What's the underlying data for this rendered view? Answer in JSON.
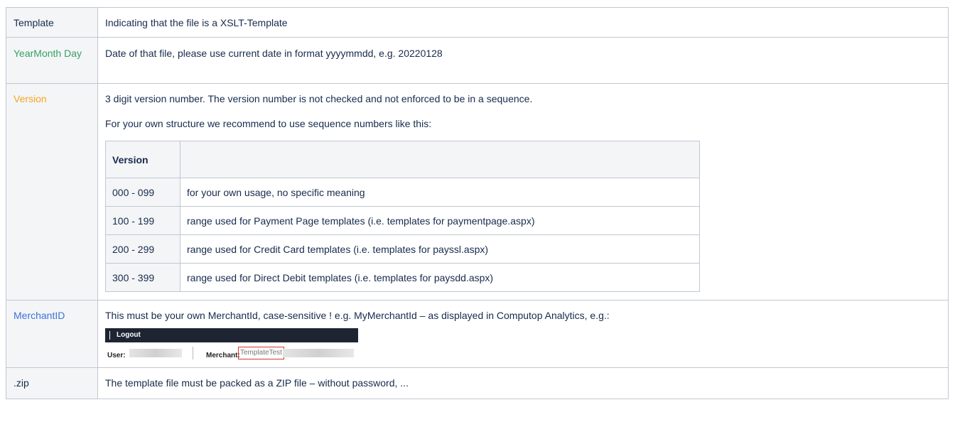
{
  "rows": {
    "template": {
      "key": "Template",
      "desc": "Indicating that the file is a XSLT-Template"
    },
    "yearmonthday": {
      "key": "YearMonth Day",
      "desc": "Date of that file, please use current date in format yyyymmdd, e.g. 20220128"
    },
    "version": {
      "key": "Version",
      "desc1": "3 digit version number. The version number is not checked and not enforced to be in a sequence.",
      "desc2": "For your own structure we recommend to use sequence numbers like this:",
      "table": {
        "header": [
          "Version",
          ""
        ],
        "rows": [
          [
            "000 - 099",
            "for your own usage, no specific meaning"
          ],
          [
            "100 - 199",
            "range used for Payment Page templates (i.e. templates for paymentpage.aspx)"
          ],
          [
            "200 - 299",
            "range used for Credit Card templates (i.e. templates for payssl.aspx)"
          ],
          [
            "300 - 399",
            "range used for Direct Debit templates (i.e. templates for paysdd.aspx)"
          ]
        ]
      }
    },
    "merchantid": {
      "key": "MerchantID",
      "desc": "This must be your own MerchantId, case-sensitive ! e.g. MyMerchantId – as displayed in Computop Analytics, e.g.:",
      "screenshot": {
        "logout": "Logout",
        "user_label": "User:",
        "merchant_label": "Merchant:",
        "merchant_value": "TemplateTest"
      }
    },
    "zip": {
      "key": ".zip",
      "desc": "The template file must be packed as a ZIP file – without password, ..."
    }
  },
  "colors": {
    "yearmonthday": "#36a162",
    "version": "#f5a623",
    "merchantid": "#3b73d8"
  }
}
